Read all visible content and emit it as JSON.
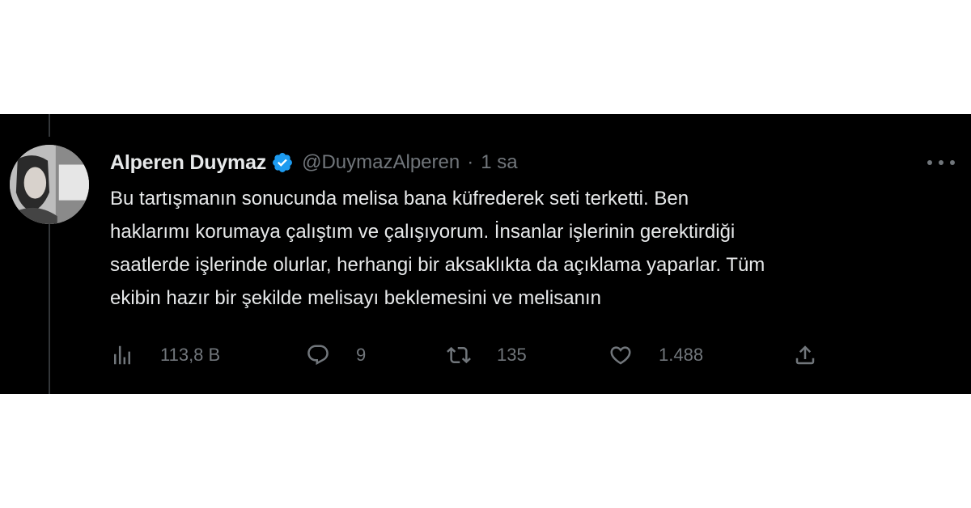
{
  "tweet": {
    "author": {
      "name": "Alperen Duymaz",
      "handle": "@DuymazAlperen",
      "verified_icon": "verified-badge-icon"
    },
    "separator": "·",
    "time": "1 sa",
    "text_lines": [
      "Bu tartışmanın sonucunda melisa bana küfrederek seti terketti. Ben",
      "haklarımı korumaya çalıştım ve çalışıyorum. İnsanlar işlerinin gerektirdiği",
      "saatlerde işlerinde olurlar, herhangi bir aksaklıkta da açıklama yaparlar. Tüm",
      "ekibin hazır bir şekilde melisayı beklemesini ve melisanın"
    ],
    "actions": {
      "views": {
        "icon": "analytics-icon",
        "count": "113,8 B"
      },
      "replies": {
        "icon": "reply-icon",
        "count": "9"
      },
      "retweets": {
        "icon": "retweet-icon",
        "count": "135"
      },
      "likes": {
        "icon": "heart-icon",
        "count": "1.488"
      },
      "share": {
        "icon": "share-icon"
      }
    }
  },
  "colors": {
    "background": "#000000",
    "primary_text": "#e7e9ea",
    "secondary_text": "#71767b",
    "verified_blue": "#1d9bf0",
    "page_background": "#ffffff"
  }
}
